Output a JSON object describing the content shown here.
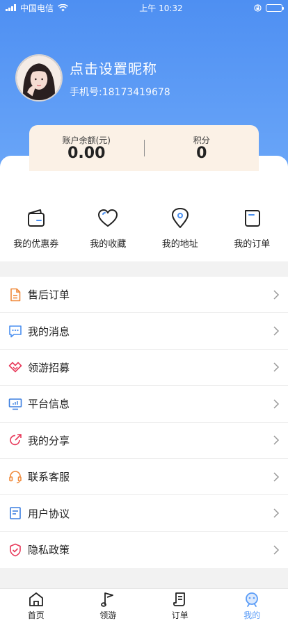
{
  "status_bar": {
    "carrier": "中国电信",
    "time": "上午 10:32"
  },
  "profile": {
    "nickname": "点击设置昵称",
    "phone": "手机号:18173419678"
  },
  "balance": {
    "account_label": "账户余额(元)",
    "account_value": "0.00",
    "points_label": "积分",
    "points_value": "0"
  },
  "quick_actions": [
    {
      "label": "我的优惠券",
      "icon": "wallet-icon"
    },
    {
      "label": "我的收藏",
      "icon": "heart-icon"
    },
    {
      "label": "我的地址",
      "icon": "location-pin-icon"
    },
    {
      "label": "我的订单",
      "icon": "order-icon"
    }
  ],
  "menu": [
    {
      "label": "售后订单",
      "icon": "document-icon",
      "color": "#f08a3c"
    },
    {
      "label": "我的消息",
      "icon": "message-icon",
      "color": "#4a8ff0"
    },
    {
      "label": "领游招募",
      "icon": "handshake-icon",
      "color": "#e8395a"
    },
    {
      "label": "平台信息",
      "icon": "monitor-icon",
      "color": "#3c7fe0"
    },
    {
      "label": "我的分享",
      "icon": "share-icon",
      "color": "#e8395a"
    },
    {
      "label": "联系客服",
      "icon": "headset-icon",
      "color": "#f08a3c"
    },
    {
      "label": "用户协议",
      "icon": "agreement-icon",
      "color": "#3c7fe0"
    },
    {
      "label": "隐私政策",
      "icon": "shield-icon",
      "color": "#e8395a"
    }
  ],
  "tabbar": [
    {
      "label": "首页",
      "icon": "home-icon"
    },
    {
      "label": "领游",
      "icon": "flag-icon"
    },
    {
      "label": "订单",
      "icon": "order-list-icon"
    },
    {
      "label": "我的",
      "icon": "profile-face-icon",
      "active": true
    }
  ],
  "colors": {
    "header_blue": "#4e8ff2",
    "accent_blue": "#5a9cf7",
    "card_bg": "#fbf1e6"
  }
}
